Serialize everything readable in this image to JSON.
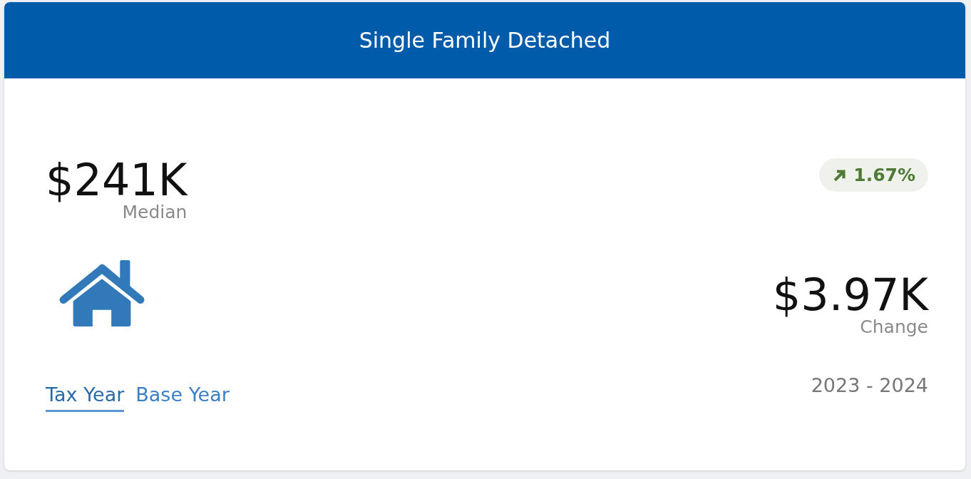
{
  "card": {
    "title": "Single Family Detached"
  },
  "median": {
    "value": "$241K",
    "label": "Median"
  },
  "change_badge": {
    "rising": true,
    "value": "1.67%"
  },
  "change": {
    "value": "$3.97K",
    "label": "Change"
  },
  "tabs": [
    {
      "label": "Tax Year",
      "selected": true
    },
    {
      "label": "Base Year",
      "selected": false
    }
  ],
  "period": "2023 - 2024"
}
